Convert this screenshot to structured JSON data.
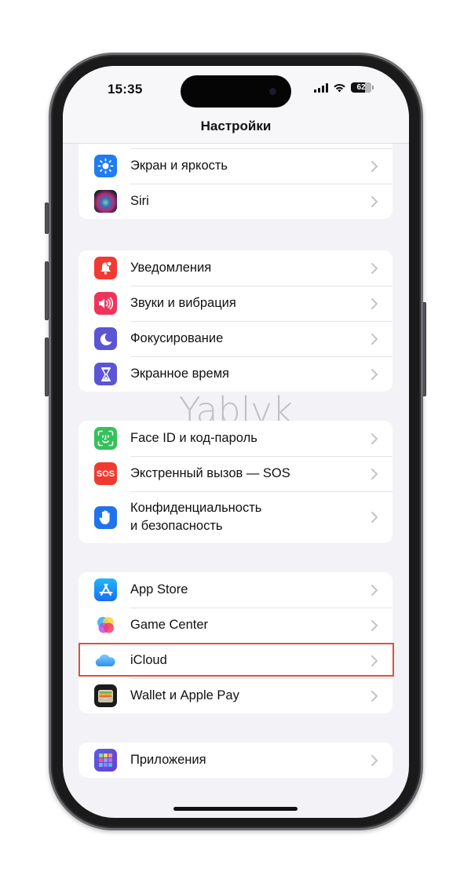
{
  "status_bar": {
    "time": "15:35",
    "battery_level": "62",
    "signal_icon": "cellular-signal-icon",
    "wifi_icon": "wifi-icon"
  },
  "header": {
    "title": "Настройки"
  },
  "watermark": "Yablyk",
  "highlight": {
    "target": "iCloud",
    "color": "#d9533e"
  },
  "groups": [
    {
      "items": [
        {
          "label": "Экран и яркость",
          "icon": "brightness-icon",
          "color": "#1f7cf2"
        },
        {
          "label": "Siri",
          "icon": "siri-icon",
          "color": "#1c1c2a"
        }
      ]
    },
    {
      "items": [
        {
          "label": "Уведомления",
          "icon": "notifications-bell-icon",
          "color": "#f13a32"
        },
        {
          "label": "Звуки и вибрация",
          "icon": "speaker-icon",
          "color": "#f0335a"
        },
        {
          "label": "Фокусирование",
          "icon": "moon-icon",
          "color": "#5b55d6"
        },
        {
          "label": "Экранное время",
          "icon": "hourglass-icon",
          "color": "#5b55d6"
        }
      ]
    },
    {
      "items": [
        {
          "label": "Face ID и код-пароль",
          "icon": "face-id-icon",
          "color": "#34c15a"
        },
        {
          "label": "Экстренный вызов — SOS",
          "icon": "sos-icon",
          "color": "#f03a30",
          "icon_text": "SOS"
        },
        {
          "label_line1": "Конфиденциальность",
          "label_line2": "и безопасность",
          "icon": "privacy-hand-icon",
          "color": "#1f74ee"
        }
      ]
    },
    {
      "items": [
        {
          "label": "App Store",
          "icon": "app-store-icon",
          "color": "#1a8cf5"
        },
        {
          "label": "Game Center",
          "icon": "game-center-icon",
          "color": "#ffffff"
        },
        {
          "label": "iCloud",
          "icon": "icloud-icon",
          "color": "#ffffff"
        },
        {
          "label": "Wallet и Apple Pay",
          "icon": "wallet-icon",
          "color": "#1c1c1e"
        }
      ]
    },
    {
      "items": [
        {
          "label": "Приложения",
          "icon": "apps-grid-icon",
          "color": "#5b4fd9"
        }
      ]
    }
  ]
}
